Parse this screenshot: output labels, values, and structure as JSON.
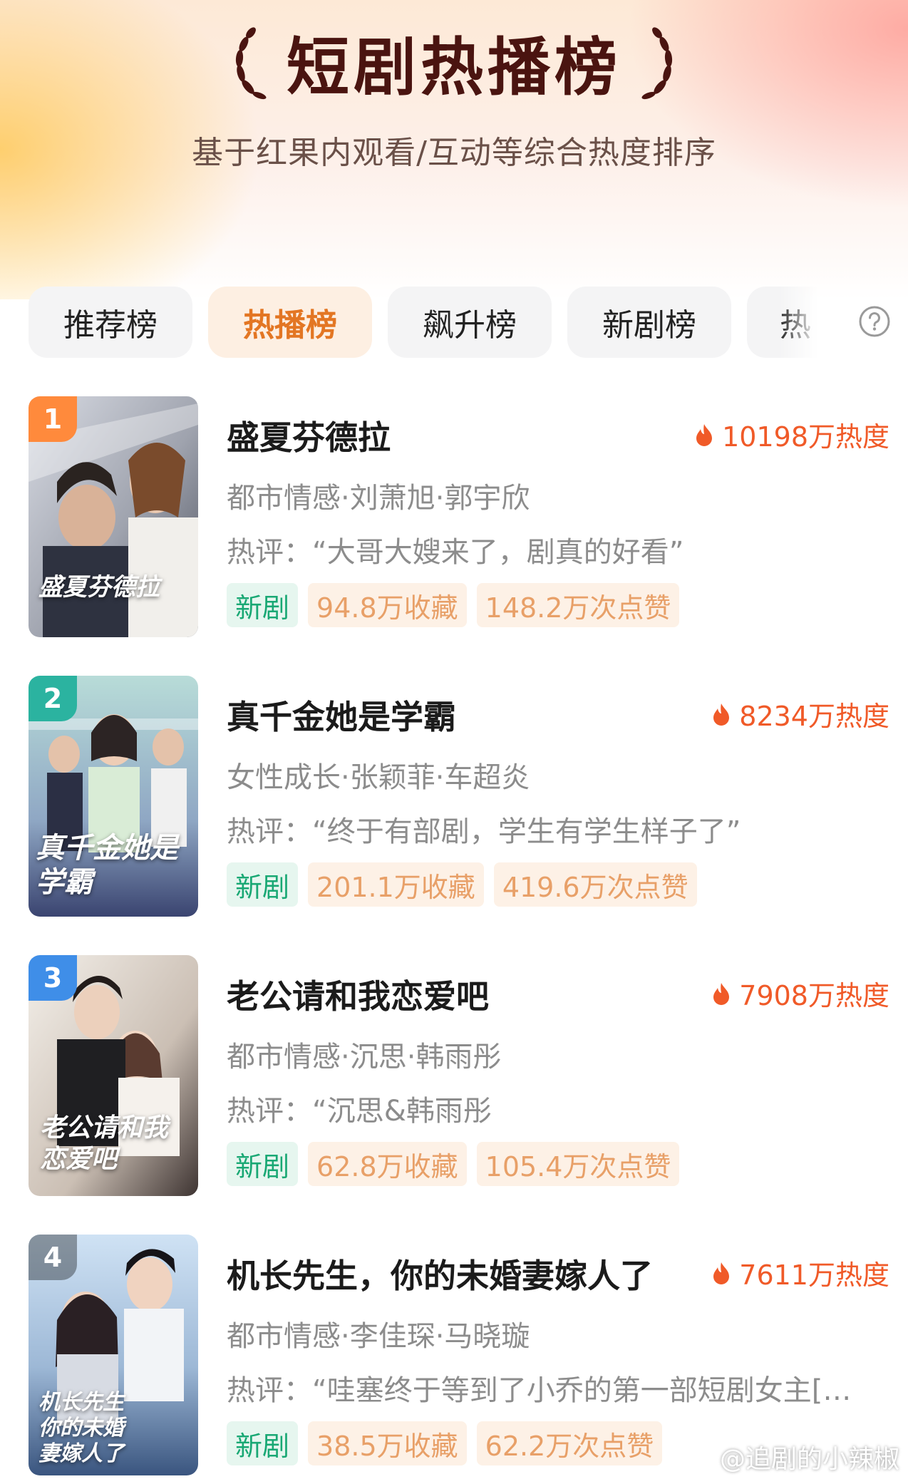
{
  "header": {
    "title": "短剧热播榜",
    "subtitle": "基于红果内观看/互动等综合热度排序"
  },
  "tabs": [
    {
      "label": "推荐榜",
      "active": false
    },
    {
      "label": "热播榜",
      "active": true
    },
    {
      "label": "飙升榜",
      "active": false
    },
    {
      "label": "新剧榜",
      "active": false
    },
    {
      "label": "热",
      "active": false
    }
  ],
  "help_icon": "question-circle-icon",
  "items": [
    {
      "rank": "1",
      "rank_color": "#ff8a3c",
      "title": "盛夏芬德拉",
      "heat": "10198万热度",
      "meta": "都市情感·刘萧旭·郭宇欣",
      "review": "热评：“大哥大嫂来了，剧真的好看”",
      "tag_new": "新剧",
      "favorites": "94.8万收藏",
      "likes": "148.2万次点赞",
      "poster_text": "盛夏芬德拉",
      "poster_colors": [
        "#c9ccd6",
        "#6b6f7c"
      ]
    },
    {
      "rank": "2",
      "rank_color": "#2bb3a0",
      "title": "真千金她是学霸",
      "heat": "8234万热度",
      "meta": "女性成长·张颖菲·车超炎",
      "review": "热评：“终于有部剧，学生有学生样子了”",
      "tag_new": "新剧",
      "favorites": "201.1万收藏",
      "likes": "419.6万次点赞",
      "poster_text": "真千金她是学霸",
      "poster_colors": [
        "#a9d2d2",
        "#3e4b78"
      ]
    },
    {
      "rank": "3",
      "rank_color": "#3f8ee8",
      "title": "老公请和我恋爱吧",
      "heat": "7908万热度",
      "meta": "都市情感·沉思·韩雨彤",
      "review": "热评：“沉思&韩雨彤",
      "tag_new": "新剧",
      "favorites": "62.8万收藏",
      "likes": "105.4万次点赞",
      "poster_text": "老公请和我恋爱吧",
      "poster_colors": [
        "#e9e2dc",
        "#4a3f3c"
      ]
    },
    {
      "rank": "4",
      "rank_color": "rgba(0,0,0,0.35)",
      "title": "机长先生，你的未婚妻嫁人了",
      "heat": "7611万热度",
      "meta": "都市情感·李佳琛·马晓璇",
      "review": "热评：“哇塞终于等到了小乔的第一部短剧女主[舔…",
      "tag_new": "新剧",
      "favorites": "38.5万收藏",
      "likes": "62.2万次点赞",
      "poster_text": "机长先生你的未婚妻嫁人了",
      "poster_colors": [
        "#c7dcf0",
        "#3d5a86"
      ]
    }
  ],
  "watermark": "@追剧的小辣椒",
  "colors": {
    "accent": "#f05a28",
    "tab_active_text": "#e37623",
    "tag_new_text": "#19a874",
    "tag_stat_text": "#e8a068"
  }
}
